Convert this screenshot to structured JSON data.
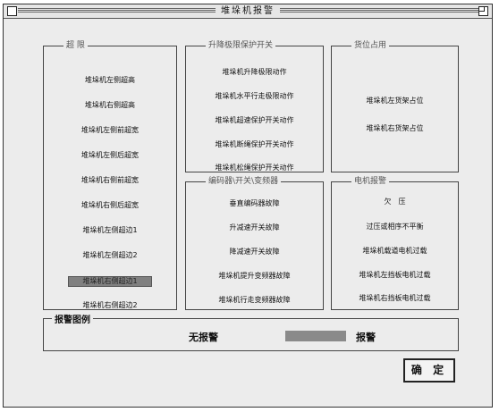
{
  "window": {
    "title": "堆垛机报警"
  },
  "groups": {
    "limit": {
      "legend": "超 限",
      "items": [
        "堆垛机左侧超高",
        "堆垛机右侧超高",
        "堆垛机左侧前超宽",
        "堆垛机左侧后超宽",
        "堆垛机右侧前超宽",
        "堆垛机右侧后超宽",
        "堆垛机左侧超边1",
        "堆垛机左侧超边2",
        "堆垛机右侧超边1",
        "堆垛机右侧超边2"
      ],
      "active_index": 8
    },
    "switch": {
      "legend": "升降极限保护开关",
      "items": [
        "堆垛机升降极限动作",
        "堆垛机水平行走极限动作",
        "堆垛机超速保护开关动作",
        "堆垛机断绳保护开关动作",
        "堆垛机松绳保护开关动作"
      ]
    },
    "occupy": {
      "legend": "货位占用",
      "items": [
        "堆垛机左货架占位",
        "堆垛机右货架占位"
      ]
    },
    "encoder": {
      "legend": "编码器\\开关\\变频器",
      "items": [
        "垂直编码器故障",
        "升减速开关故障",
        "降减速开关故障",
        "堆垛机提升变频器故障",
        "堆垛机行走变频器故障"
      ]
    },
    "motor": {
      "legend": "电机报警",
      "items": [
        "欠　压",
        "过压或相序不平衡",
        "堆垛机载道电机过载",
        "堆垛机左挡板电机过载",
        "堆垛机右挡板电机过载"
      ]
    }
  },
  "alarm_legend": {
    "title": "报警图例",
    "no_alarm": "无报警",
    "alarm": "报警",
    "alarm_color": "#8a8a8a"
  },
  "buttons": {
    "ok": "确 定"
  }
}
